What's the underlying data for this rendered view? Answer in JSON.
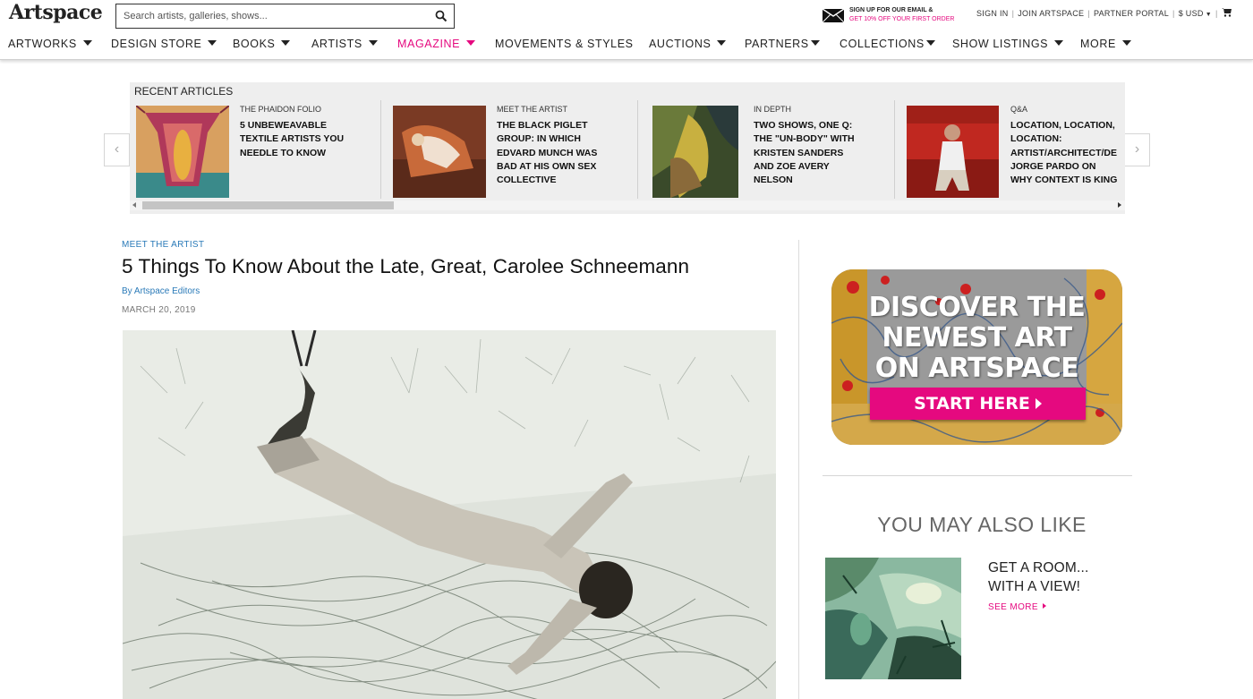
{
  "header": {
    "logo": "Artspace",
    "search_placeholder": "Search artists, galleries, shows...",
    "promo_line1": "SIGN UP FOR OUR EMAIL &",
    "promo_line2": "GET 10% OFF YOUR FIRST ORDER",
    "sign_in": "SIGN IN",
    "join": "JOIN ARTSPACE",
    "partner_portal": "PARTNER PORTAL",
    "currency": "$ USD"
  },
  "nav": [
    {
      "label": "ARTWORKS"
    },
    {
      "label": "DESIGN STORE"
    },
    {
      "label": "BOOKS"
    },
    {
      "label": "ARTISTS"
    },
    {
      "label": "MAGAZINE"
    },
    {
      "label": "MOVEMENTS & STYLES"
    },
    {
      "label": "AUCTIONS"
    },
    {
      "label": "PARTNERS"
    },
    {
      "label": "COLLECTIONS"
    },
    {
      "label": "SHOW LISTINGS"
    },
    {
      "label": "MORE"
    }
  ],
  "recent": {
    "title": "RECENT ARTICLES",
    "cards": [
      {
        "category": "THE PHAIDON FOLIO",
        "title": "5 UNBEWEAVABLE TEXTILE ARTISTS YOU NEEDLE TO KNOW"
      },
      {
        "category": "MEET THE ARTIST",
        "title": "THE BLACK PIGLET GROUP: IN WHICH EDVARD MUNCH WAS BAD AT HIS OWN SEX COLLECTIVE"
      },
      {
        "category": "IN DEPTH",
        "title": "TWO SHOWS, ONE Q: THE \"UN-BODY\" WITH KRISTEN SANDERS AND ZOE AVERY NELSON"
      },
      {
        "category": "Q&A",
        "title": "LOCATION, LOCATION, LOCATION: ARTIST/ARCHITECT/DE JORGE PARDO ON WHY CONTEXT IS KING"
      }
    ]
  },
  "article": {
    "kicker": "MEET THE ARTIST",
    "headline": "5 Things To Know About the Late, Great, Carolee Schneemann",
    "byline": "By Artspace Editors",
    "date": "MARCH 20, 2019"
  },
  "ad": {
    "line1": "DISCOVER THE",
    "line2": "NEWEST ART",
    "line3": "ON ARTSPACE",
    "cta": "START HERE"
  },
  "also_like": {
    "heading": "YOU MAY ALSO LIKE",
    "title_line1": "GET A ROOM...",
    "title_line2": "WITH A VIEW!",
    "see_more": "SEE MORE"
  },
  "colors": {
    "accent": "#e5097f",
    "link": "#2a7ab8"
  }
}
